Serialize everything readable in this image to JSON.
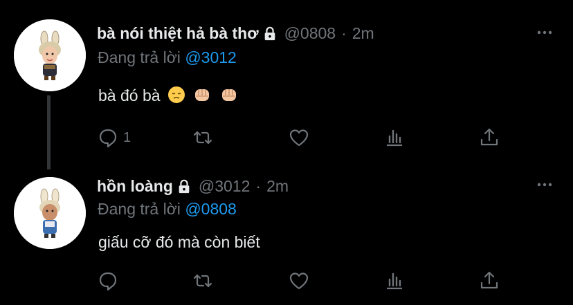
{
  "tweets": [
    {
      "display_name": "bà nói thiệt hả bà thơ",
      "handle": "@0808",
      "time": "2m",
      "replying_label": "Đang trả lời",
      "replying_to": "@3012",
      "text": "bà đó bà",
      "emojis": [
        "pensive-face",
        "oncoming-fist",
        "oncoming-fist"
      ],
      "reply_count": "1"
    },
    {
      "display_name": "hồn loàng",
      "handle": "@3012",
      "time": "2m",
      "replying_label": "Đang trả lời",
      "replying_to": "@0808",
      "text": "giấu cỡ đó mà còn biết",
      "emojis": [],
      "reply_count": ""
    }
  ],
  "separator": "·",
  "colors": {
    "background": "#000000",
    "text": "#e7e9ea",
    "muted": "#71767b",
    "link": "#1d9bf0",
    "thread_line": "#333639"
  },
  "icons": [
    "more-icon",
    "lock-icon",
    "reply-icon",
    "retweet-icon",
    "like-icon",
    "analytics-icon",
    "share-icon"
  ]
}
